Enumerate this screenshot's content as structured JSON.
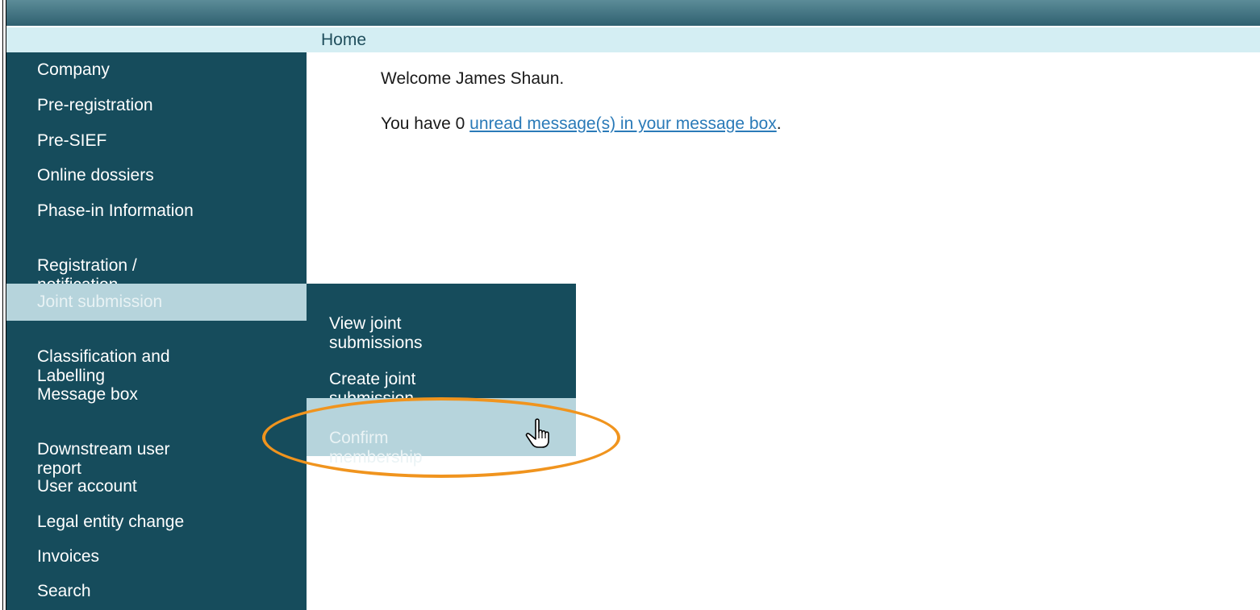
{
  "breadcrumb": "Home",
  "sidebar": {
    "items": [
      {
        "label": "Company"
      },
      {
        "label": "Pre-registration"
      },
      {
        "label": "Pre-SIEF"
      },
      {
        "label": "Online dossiers"
      },
      {
        "label": "Phase-in Information"
      },
      {
        "label": "Registration /\nnotification"
      },
      {
        "label": "Joint submission",
        "active": true
      },
      {
        "label": "Classification and\nLabelling"
      },
      {
        "label": "Message box"
      },
      {
        "label": "Downstream user\nreport"
      },
      {
        "label": "User account"
      },
      {
        "label": "Legal entity change"
      },
      {
        "label": "Invoices"
      },
      {
        "label": "Search"
      }
    ]
  },
  "submenu": {
    "items": [
      {
        "label": "View joint\nsubmissions"
      },
      {
        "label": "Create joint\nsubmission"
      },
      {
        "label": "Confirm\nmembership",
        "hover": true
      }
    ]
  },
  "main": {
    "welcome": "Welcome James Shaun.",
    "messages_prefix": "You have 0 ",
    "messages_link": "unread message(s) in your message box",
    "messages_suffix": "."
  },
  "icons": {
    "cursor": "hand-pointer-icon"
  },
  "colors": {
    "sidebar_bg": "#164c5c",
    "active_bg": "#b6d4dc",
    "breadcrumb_bg": "#d4eef3",
    "highlight": "#f0941e",
    "link": "#2a7ab8"
  }
}
